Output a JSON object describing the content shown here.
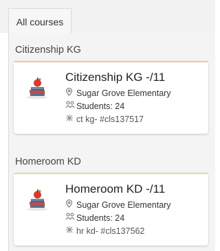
{
  "tabs": [
    {
      "label": "All courses",
      "active": true
    }
  ],
  "groups": [
    {
      "heading": "Citizenship KG",
      "card": {
        "title": "Citizenship KG -/11",
        "school": "Sugar Grove Elementary",
        "students": "Students: 24",
        "code": "ct kg- #cls137517",
        "accent": "#f0c8a0"
      }
    },
    {
      "heading": "Homeroom KD",
      "card": {
        "title": "Homeroom KD -/11",
        "school": "Sugar Grove Elementary",
        "students": "Students: 24",
        "code": "hr kd- #cls137562",
        "accent": "#e6d9a0"
      }
    }
  ],
  "icons": {
    "location": "location-pin-icon",
    "students": "students-icon",
    "code": "class-code-icon",
    "thumb": "apple-books-icon"
  }
}
